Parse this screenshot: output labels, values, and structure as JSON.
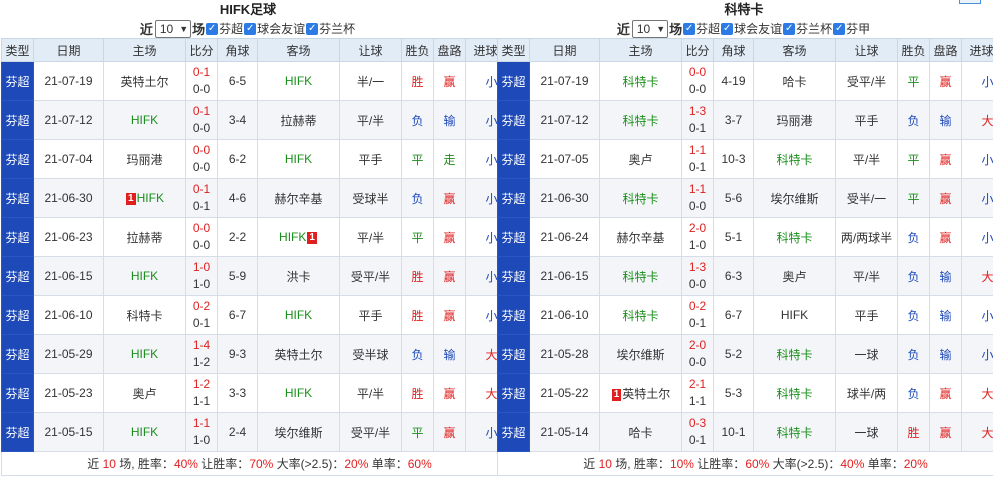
{
  "left": {
    "title": "HIFK足球",
    "filter": {
      "near": "近",
      "count": "10",
      "chang": "场",
      "checks": [
        "芬超",
        "球会友谊",
        "芬兰杯"
      ]
    },
    "headers": [
      "类型",
      "日期",
      "主场",
      "比分",
      "角球",
      "客场",
      "让球",
      "胜负",
      "盘路",
      "进球数"
    ],
    "rows": [
      {
        "type": "芬超",
        "date": "21-07-19",
        "home": "英特土尔",
        "home_hl": false,
        "home_red": "",
        "ft": "0-1",
        "ht": "0-0",
        "corner": "6-5",
        "away": "HIFK",
        "away_hl": true,
        "away_red": "",
        "hcp": "半/一",
        "result": "胜",
        "result_cls": "win",
        "pan": "赢",
        "pan_cls": "win",
        "goals": "小",
        "goals_cls": "small"
      },
      {
        "type": "芬超",
        "date": "21-07-12",
        "home": "HIFK",
        "home_hl": true,
        "home_red": "",
        "ft": "0-1",
        "ht": "0-0",
        "corner": "3-4",
        "away": "拉赫蒂",
        "away_hl": false,
        "away_red": "",
        "hcp": "平/半",
        "result": "负",
        "result_cls": "loss",
        "pan": "输",
        "pan_cls": "loss",
        "goals": "小",
        "goals_cls": "small"
      },
      {
        "type": "芬超",
        "date": "21-07-04",
        "home": "玛丽港",
        "home_hl": false,
        "home_red": "",
        "ft": "0-0",
        "ht": "0-0",
        "corner": "6-2",
        "away": "HIFK",
        "away_hl": true,
        "away_red": "",
        "hcp": "平手",
        "result": "平",
        "result_cls": "draw",
        "pan": "走",
        "pan_cls": "draw",
        "goals": "小",
        "goals_cls": "small"
      },
      {
        "type": "芬超",
        "date": "21-06-30",
        "home": "HIFK",
        "home_hl": true,
        "home_red": "1",
        "ft": "0-1",
        "ht": "0-1",
        "corner": "4-6",
        "away": "赫尔辛基",
        "away_hl": false,
        "away_red": "",
        "hcp": "受球半",
        "result": "负",
        "result_cls": "loss",
        "pan": "赢",
        "pan_cls": "win",
        "goals": "小",
        "goals_cls": "small"
      },
      {
        "type": "芬超",
        "date": "21-06-23",
        "home": "拉赫蒂",
        "home_hl": false,
        "home_red": "",
        "ft": "0-0",
        "ht": "0-0",
        "corner": "2-2",
        "away": "HIFK",
        "away_hl": true,
        "away_red": "1",
        "hcp": "平/半",
        "result": "平",
        "result_cls": "draw",
        "pan": "赢",
        "pan_cls": "win",
        "goals": "小",
        "goals_cls": "small"
      },
      {
        "type": "芬超",
        "date": "21-06-15",
        "home": "HIFK",
        "home_hl": true,
        "home_red": "",
        "ft": "1-0",
        "ht": "1-0",
        "corner": "5-9",
        "away": "洪卡",
        "away_hl": false,
        "away_red": "",
        "hcp": "受平/半",
        "result": "胜",
        "result_cls": "win",
        "pan": "赢",
        "pan_cls": "win",
        "goals": "小",
        "goals_cls": "small"
      },
      {
        "type": "芬超",
        "date": "21-06-10",
        "home": "科特卡",
        "home_hl": false,
        "home_red": "",
        "ft": "0-2",
        "ht": "0-1",
        "corner": "6-7",
        "away": "HIFK",
        "away_hl": true,
        "away_red": "",
        "hcp": "平手",
        "result": "胜",
        "result_cls": "win",
        "pan": "赢",
        "pan_cls": "win",
        "goals": "小",
        "goals_cls": "small"
      },
      {
        "type": "芬超",
        "date": "21-05-29",
        "home": "HIFK",
        "home_hl": true,
        "home_red": "",
        "ft": "1-4",
        "ht": "1-2",
        "corner": "9-3",
        "away": "英特土尔",
        "away_hl": false,
        "away_red": "",
        "hcp": "受半球",
        "result": "负",
        "result_cls": "loss",
        "pan": "输",
        "pan_cls": "loss",
        "goals": "大",
        "goals_cls": "big"
      },
      {
        "type": "芬超",
        "date": "21-05-23",
        "home": "奥卢",
        "home_hl": false,
        "home_red": "",
        "ft": "1-2",
        "ht": "1-1",
        "corner": "3-3",
        "away": "HIFK",
        "away_hl": true,
        "away_red": "",
        "hcp": "平/半",
        "result": "胜",
        "result_cls": "win",
        "pan": "赢",
        "pan_cls": "win",
        "goals": "大",
        "goals_cls": "big"
      },
      {
        "type": "芬超",
        "date": "21-05-15",
        "home": "HIFK",
        "home_hl": true,
        "home_red": "",
        "ft": "1-1",
        "ht": "1-0",
        "corner": "2-4",
        "away": "埃尔维斯",
        "away_hl": false,
        "away_red": "",
        "hcp": "受平/半",
        "result": "平",
        "result_cls": "draw",
        "pan": "赢",
        "pan_cls": "win",
        "goals": "小",
        "goals_cls": "small"
      }
    ],
    "summary": {
      "p1": "近 ",
      "n": "10",
      "p2": " 场, 胜率：",
      "win": "40%",
      "p3": " 让胜率：",
      "hcp": "70%",
      "p4": " 大率(>2.5)：",
      "big": "20%",
      "p5": " 单率：",
      "odd": "60%"
    }
  },
  "right": {
    "title": "科特卡",
    "filter": {
      "near": "近",
      "count": "10",
      "chang": "场",
      "checks": [
        "芬超",
        "球会友谊",
        "芬兰杯",
        "芬甲"
      ]
    },
    "headers": [
      "类型",
      "日期",
      "主场",
      "比分",
      "角球",
      "客场",
      "让球",
      "胜负",
      "盘路",
      "进球数"
    ],
    "rows": [
      {
        "type": "芬超",
        "date": "21-07-19",
        "home": "科特卡",
        "home_hl": true,
        "home_red": "",
        "ft": "0-0",
        "ht": "0-0",
        "corner": "4-19",
        "away": "哈卡",
        "away_hl": false,
        "away_red": "",
        "hcp": "受平/半",
        "result": "平",
        "result_cls": "draw",
        "pan": "赢",
        "pan_cls": "win",
        "goals": "小",
        "goals_cls": "small"
      },
      {
        "type": "芬超",
        "date": "21-07-12",
        "home": "科特卡",
        "home_hl": true,
        "home_red": "",
        "ft": "1-3",
        "ht": "0-1",
        "corner": "3-7",
        "away": "玛丽港",
        "away_hl": false,
        "away_red": "",
        "hcp": "平手",
        "result": "负",
        "result_cls": "loss",
        "pan": "输",
        "pan_cls": "loss",
        "goals": "大",
        "goals_cls": "big"
      },
      {
        "type": "芬超",
        "date": "21-07-05",
        "home": "奥卢",
        "home_hl": false,
        "home_red": "",
        "ft": "1-1",
        "ht": "0-1",
        "corner": "10-3",
        "away": "科特卡",
        "away_hl": true,
        "away_red": "",
        "hcp": "平/半",
        "result": "平",
        "result_cls": "draw",
        "pan": "赢",
        "pan_cls": "win",
        "goals": "小",
        "goals_cls": "small"
      },
      {
        "type": "芬超",
        "date": "21-06-30",
        "home": "科特卡",
        "home_hl": true,
        "home_red": "",
        "ft": "1-1",
        "ht": "0-0",
        "corner": "5-6",
        "away": "埃尔维斯",
        "away_hl": false,
        "away_red": "",
        "hcp": "受半/一",
        "result": "平",
        "result_cls": "draw",
        "pan": "赢",
        "pan_cls": "win",
        "goals": "小",
        "goals_cls": "small"
      },
      {
        "type": "芬超",
        "date": "21-06-24",
        "home": "赫尔辛基",
        "home_hl": false,
        "home_red": "",
        "ft": "2-0",
        "ht": "1-0",
        "corner": "5-1",
        "away": "科特卡",
        "away_hl": true,
        "away_red": "",
        "hcp": "两/两球半",
        "result": "负",
        "result_cls": "loss",
        "pan": "赢",
        "pan_cls": "win",
        "goals": "小",
        "goals_cls": "small"
      },
      {
        "type": "芬超",
        "date": "21-06-15",
        "home": "科特卡",
        "home_hl": true,
        "home_red": "",
        "ft": "1-3",
        "ht": "0-0",
        "corner": "6-3",
        "away": "奥卢",
        "away_hl": false,
        "away_red": "",
        "hcp": "平/半",
        "result": "负",
        "result_cls": "loss",
        "pan": "输",
        "pan_cls": "loss",
        "goals": "大",
        "goals_cls": "big"
      },
      {
        "type": "芬超",
        "date": "21-06-10",
        "home": "科特卡",
        "home_hl": true,
        "home_red": "",
        "ft": "0-2",
        "ht": "0-1",
        "corner": "6-7",
        "away": "HIFK",
        "away_hl": false,
        "away_red": "",
        "hcp": "平手",
        "result": "负",
        "result_cls": "loss",
        "pan": "输",
        "pan_cls": "loss",
        "goals": "小",
        "goals_cls": "small"
      },
      {
        "type": "芬超",
        "date": "21-05-28",
        "home": "埃尔维斯",
        "home_hl": false,
        "home_red": "",
        "ft": "2-0",
        "ht": "0-0",
        "corner": "5-2",
        "away": "科特卡",
        "away_hl": true,
        "away_red": "",
        "hcp": "一球",
        "result": "负",
        "result_cls": "loss",
        "pan": "输",
        "pan_cls": "loss",
        "goals": "小",
        "goals_cls": "small"
      },
      {
        "type": "芬超",
        "date": "21-05-22",
        "home": "英特土尔",
        "home_hl": false,
        "home_red": "1",
        "ft": "2-1",
        "ht": "1-1",
        "corner": "5-3",
        "away": "科特卡",
        "away_hl": true,
        "away_red": "",
        "hcp": "球半/两",
        "result": "负",
        "result_cls": "loss",
        "pan": "赢",
        "pan_cls": "win",
        "goals": "大",
        "goals_cls": "big"
      },
      {
        "type": "芬超",
        "date": "21-05-14",
        "home": "哈卡",
        "home_hl": false,
        "home_red": "",
        "ft": "0-3",
        "ht": "0-1",
        "corner": "10-1",
        "away": "科特卡",
        "away_hl": true,
        "away_red": "",
        "hcp": "一球",
        "result": "胜",
        "result_cls": "win",
        "pan": "赢",
        "pan_cls": "win",
        "goals": "大",
        "goals_cls": "big"
      }
    ],
    "summary": {
      "p1": "近 ",
      "n": "10",
      "p2": " 场, 胜率：",
      "win": "10%",
      "p3": " 让胜率：",
      "hcp": "60%",
      "p4": " 大率(>2.5)：",
      "big": "40%",
      "p5": " 单率：",
      "odd": "20%"
    }
  }
}
